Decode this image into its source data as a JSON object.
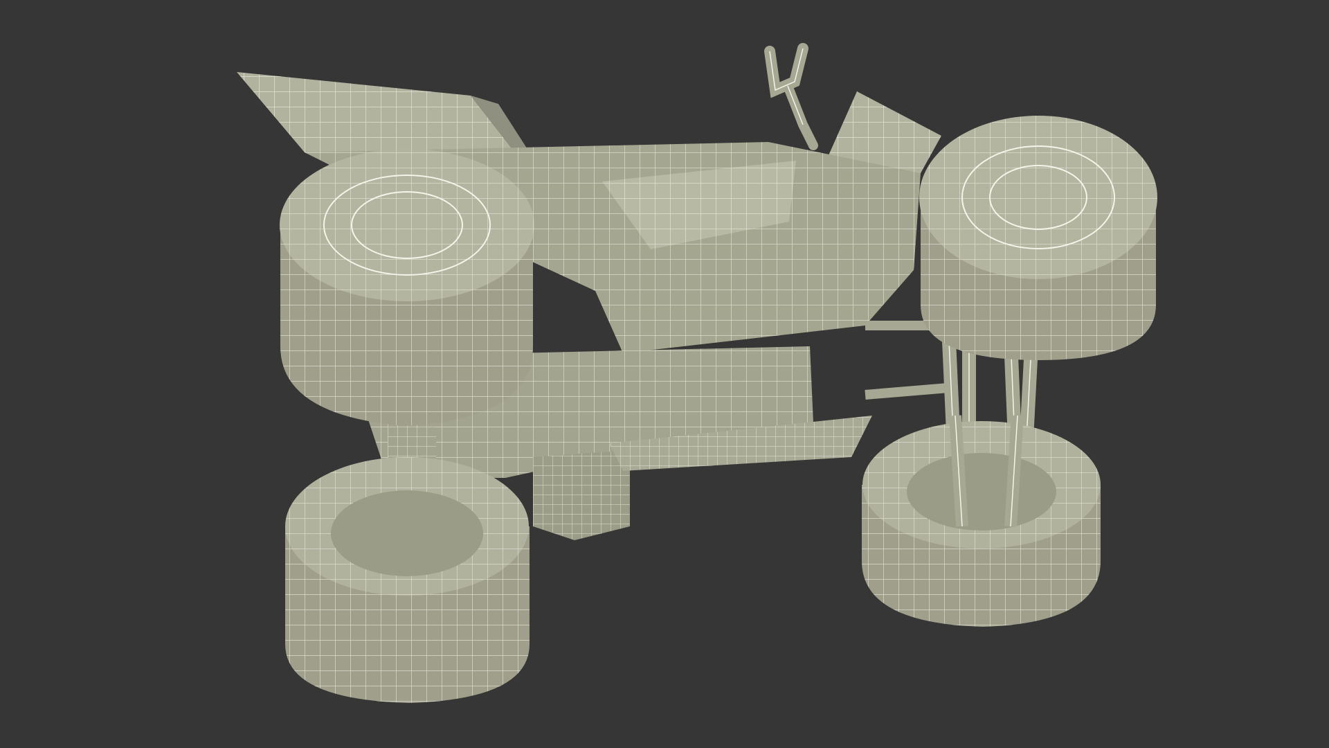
{
  "scene": {
    "background_color": "#363636",
    "model_fill": "#a7a893",
    "model_fill_light": "#bbbba6",
    "model_fill_dark": "#8b8c7b",
    "wire_color": "#f4f4ea",
    "subject": "atv-wireframe-model"
  }
}
